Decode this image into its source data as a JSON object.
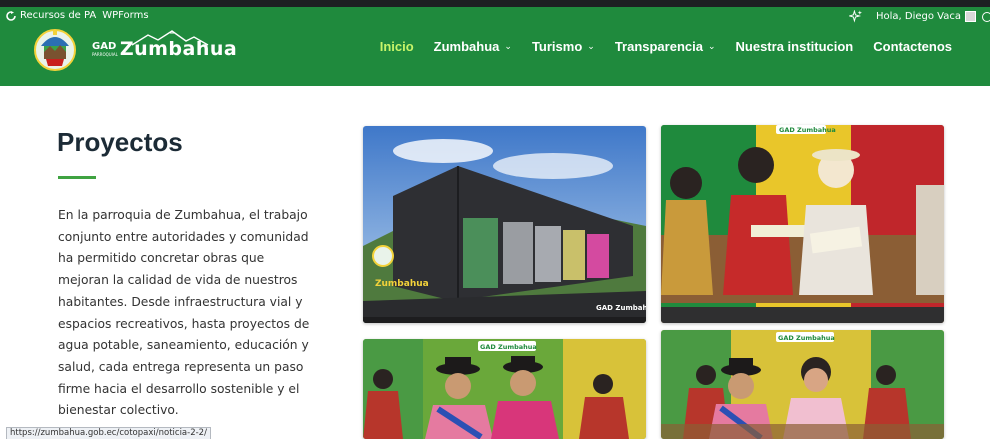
{
  "admin_bar": {
    "resources_label": "Recursos de PA",
    "wpforms_label": "WPForms",
    "greeting": "Hola, Diego Vaca"
  },
  "brand": {
    "gad": "GAD",
    "gad_small": "PARROQUIAL",
    "name": "Zumbahua"
  },
  "nav": {
    "items": [
      {
        "label": "Inicio",
        "has_dropdown": false,
        "active": true
      },
      {
        "label": "Zumbahua",
        "has_dropdown": true,
        "active": false
      },
      {
        "label": "Turismo",
        "has_dropdown": true,
        "active": false
      },
      {
        "label": "Transparencia",
        "has_dropdown": true,
        "active": false
      },
      {
        "label": "Nuestra institucion",
        "has_dropdown": false,
        "active": false
      },
      {
        "label": "Contactenos",
        "has_dropdown": false,
        "active": false
      }
    ],
    "caret_glyph": "⌄"
  },
  "section": {
    "title": "Proyectos",
    "paragraph": "En la parroquia de Zumbahua, el trabajo conjunto entre autoridades y comunidad ha permitido concretar obras que mejoran la calidad de vida de nuestros habitantes. Desde infraestructura vial y espacios recreativos, hasta proyectos de agua potable, saneamiento, educación y salud, cada entrega representa un paso firme hacia el desarrollo sostenible y el bienestar colectivo."
  },
  "cards": [
    {
      "watermark": "GAD Zumbahua"
    },
    {
      "watermark": "GAD Zumbahua"
    },
    {
      "watermark": "GAD Zumbahua"
    },
    {
      "watermark": "GAD Zumbahua"
    }
  ],
  "status_bar": {
    "url": "https://zumbahua.gob.ec/cotopaxi/noticia-2-2/"
  },
  "colors": {
    "header_green": "#1f8a3d",
    "active_nav": "#c8f56a",
    "accent_rule": "#3fa341",
    "title_text": "#1c2b36"
  },
  "icons": {
    "admin_refresh": "refresh-icon",
    "admin_sparkle": "sparkle-icon",
    "admin_avatar": "avatar-icon",
    "admin_search": "search-icon"
  }
}
